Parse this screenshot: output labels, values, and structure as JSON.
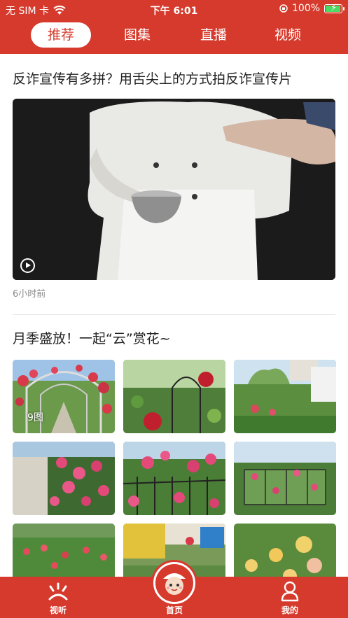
{
  "status_bar": {
    "carrier": "无 SIM 卡",
    "time": "下午 6:01",
    "battery": "100%",
    "battery_level": 1.0,
    "wifi_icon": "wifi-icon",
    "lock_icon": "orientation-lock-icon"
  },
  "tabs": [
    {
      "label": "推荐",
      "active": true
    },
    {
      "label": "图集",
      "active": false
    },
    {
      "label": "直播",
      "active": false
    },
    {
      "label": "视频",
      "active": false
    }
  ],
  "articles": [
    {
      "title": "反诈宣传有多拼？用舌尖上的方式拍反诈宣传片",
      "time": "6小时前",
      "type": "video"
    },
    {
      "title": "月季盛放！一起“云”赏花~",
      "type": "gallery",
      "image_count_label": "9图"
    }
  ],
  "bottom_nav": [
    {
      "label": "视听",
      "icon": "sun-rays-icon"
    },
    {
      "label": "首页",
      "icon": "mascot-logo-icon"
    },
    {
      "label": "我的",
      "icon": "user-icon"
    }
  ],
  "colors": {
    "brand_red": "#d63a2c",
    "text_dark": "#222222",
    "text_gray": "#888888"
  }
}
